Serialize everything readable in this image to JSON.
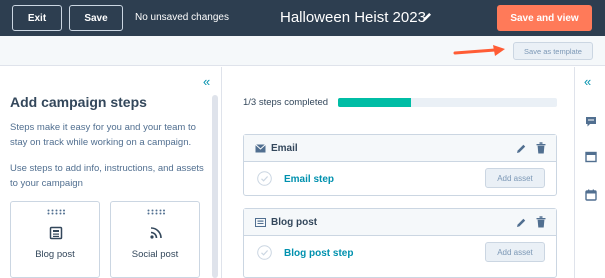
{
  "topbar": {
    "exit_label": "Exit",
    "save_label": "Save",
    "status": "No unsaved changes",
    "title": "Halloween Heist 2023",
    "save_and_view_label": "Save and view"
  },
  "subbar": {
    "save_template_label": "Save as template"
  },
  "left_panel": {
    "title": "Add campaign steps",
    "description_1": "Steps make it easy for you and your team to stay on track while working on a campaign.",
    "description_2": "Use steps to add info, instructions, and assets to your campaign",
    "cards": [
      {
        "label": "Blog post",
        "icon": "newspaper-icon"
      },
      {
        "label": "Social post",
        "icon": "rss-icon"
      }
    ]
  },
  "progress": {
    "text": "1/3 steps completed",
    "completed": 1,
    "total": 3
  },
  "steps": [
    {
      "title": "Email",
      "icon": "email-icon",
      "step_name": "Email step",
      "button": "Add asset"
    },
    {
      "title": "Blog post",
      "icon": "blog-icon",
      "step_name": "Blog post step",
      "button": "Add asset"
    }
  ],
  "right_sidebar": {
    "icons": [
      "chat-icon",
      "window-icon",
      "calendar-icon"
    ]
  },
  "colors": {
    "topbar": "#2d3e50",
    "accent_orange": "#ff7a59",
    "progress": "#00bda5",
    "link": "#0091ae"
  }
}
